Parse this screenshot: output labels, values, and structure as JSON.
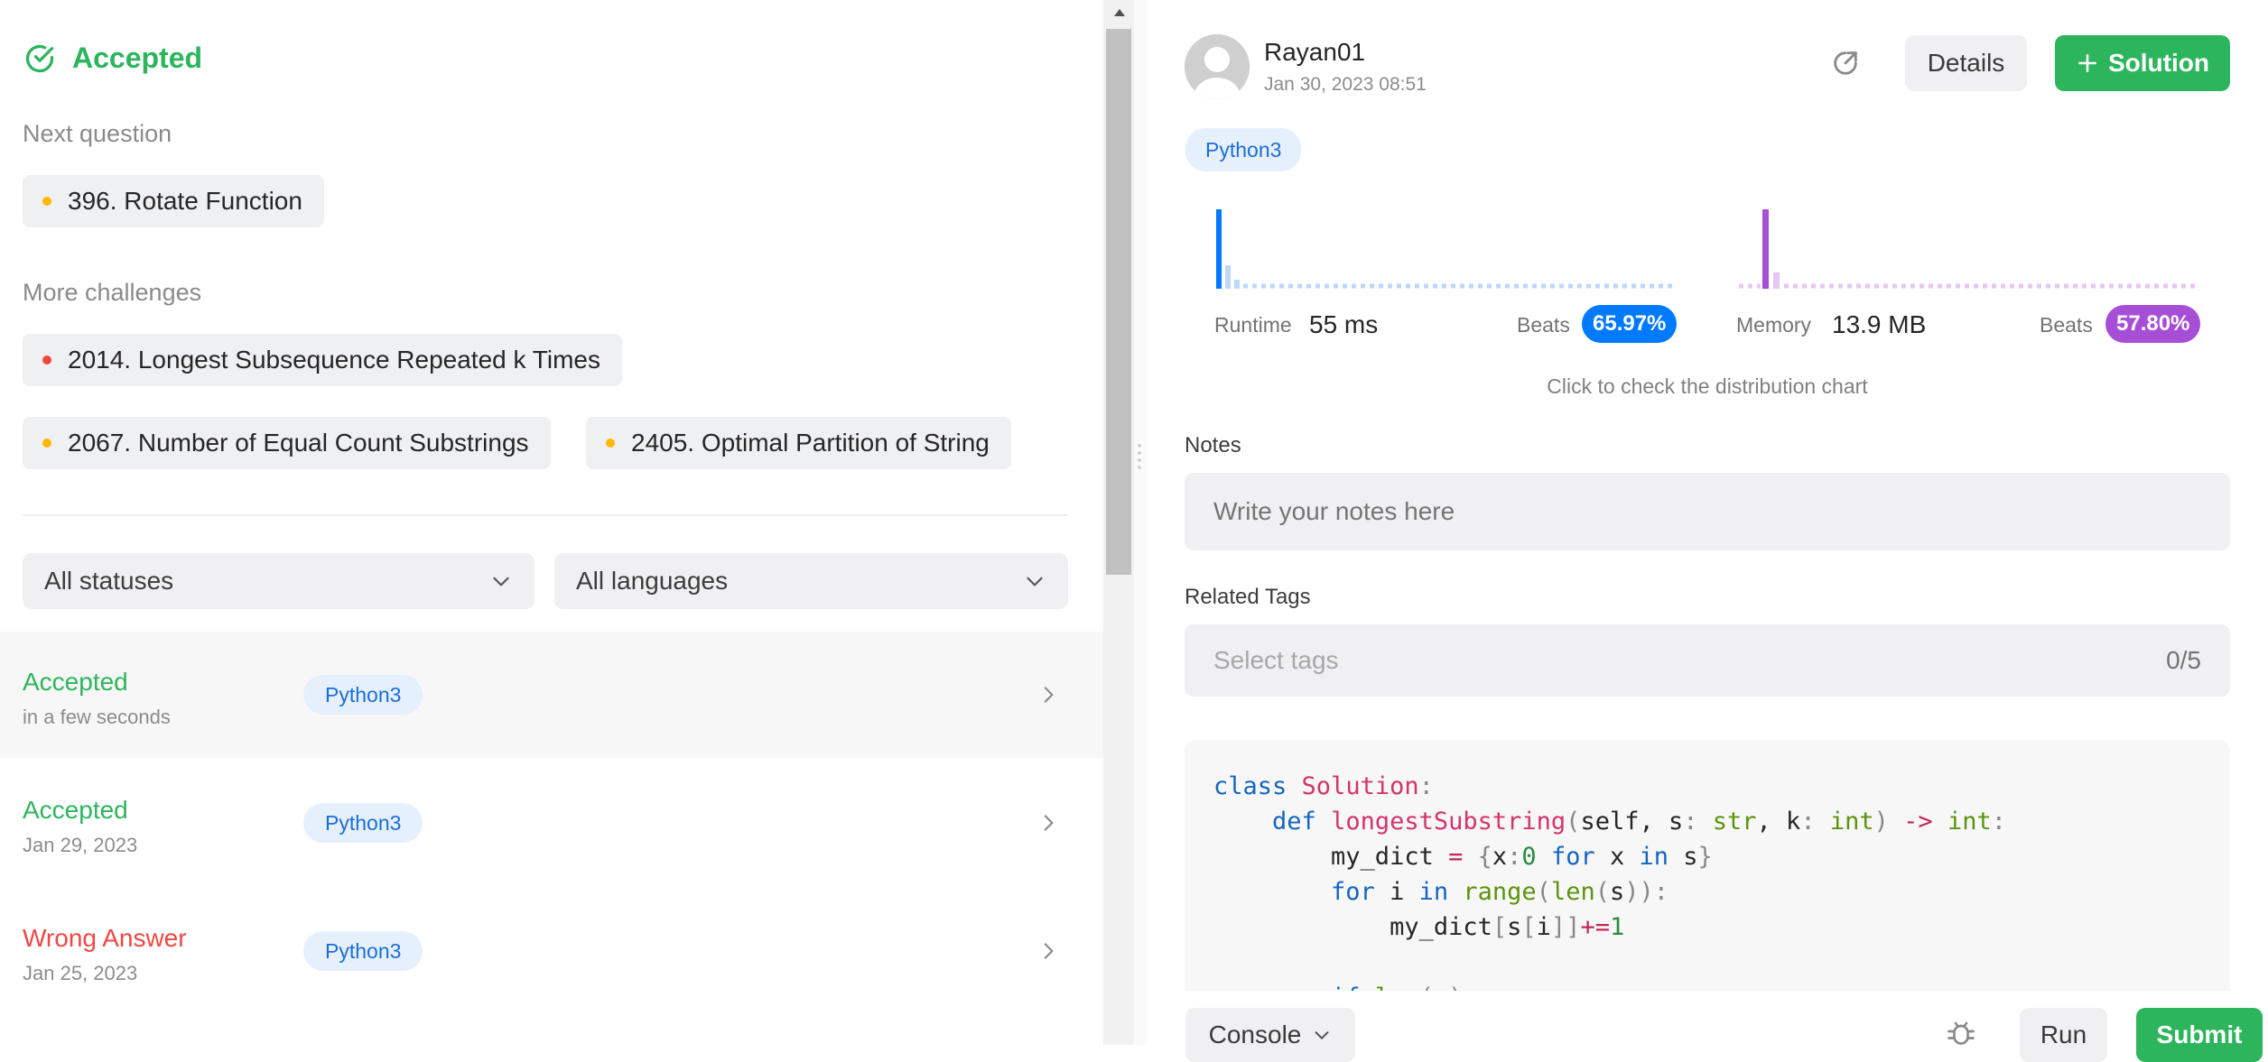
{
  "result": {
    "status": "Accepted"
  },
  "next_question": {
    "label": "Next question",
    "item": {
      "title": "396. Rotate Function",
      "dot_color": "#ffb800"
    }
  },
  "more_challenges": {
    "label": "More challenges",
    "items": [
      {
        "title": "2014. Longest Subsequence Repeated k Times",
        "dot_color": "#ef4743"
      },
      {
        "title": "2067. Number of Equal Count Substrings",
        "dot_color": "#ffb800"
      },
      {
        "title": "2405. Optimal Partition of String",
        "dot_color": "#ffb800"
      }
    ]
  },
  "filters": {
    "status_value": "All statuses",
    "language_value": "All languages"
  },
  "submissions": [
    {
      "status": "Accepted",
      "date": "in a few seconds",
      "language": "Python3",
      "status_color": "#2db55d",
      "selected": true
    },
    {
      "status": "Accepted",
      "date": "Jan 29, 2023",
      "language": "Python3",
      "status_color": "#2db55d",
      "selected": false
    },
    {
      "status": "Wrong Answer",
      "date": "Jan 25, 2023",
      "language": "Python3",
      "status_color": "#ef4743",
      "selected": false
    }
  ],
  "detail": {
    "user": "Rayan01",
    "timestamp": "Jan 30, 2023 08:51",
    "details_label": "Details",
    "solution_label": "Solution",
    "language": "Python3",
    "runtime": {
      "label": "Runtime",
      "value": "55 ms",
      "beats_label": "Beats",
      "beats": "65.97%",
      "color": "#007aff"
    },
    "memory": {
      "label": "Memory",
      "value": "13.9 MB",
      "beats_label": "Beats",
      "beats": "57.80%",
      "color": "#a64fd6"
    },
    "distribution_hint": "Click to check the distribution chart",
    "notes_label": "Notes",
    "notes_placeholder": "Write your notes here",
    "tags_label": "Related Tags",
    "tags_placeholder": "Select tags",
    "tags_count": "0/5"
  },
  "code_lines": [
    "class Solution:",
    "    def longestSubstring(self, s: str, k: int) -> int:",
    "        my_dict = {x:0 for x in s}",
    "        for i in range(len(s)):",
    "            my_dict[s[i]]+=1",
    "",
    "        if len(s) <"
  ],
  "bottom_bar": {
    "console_label": "Console",
    "run_label": "Run",
    "submit_label": "Submit"
  },
  "colors": {
    "accent_green": "#2db55d",
    "error_red": "#ef4743",
    "runtime_blue": "#007aff",
    "memory_purple": "#a64fd6"
  }
}
